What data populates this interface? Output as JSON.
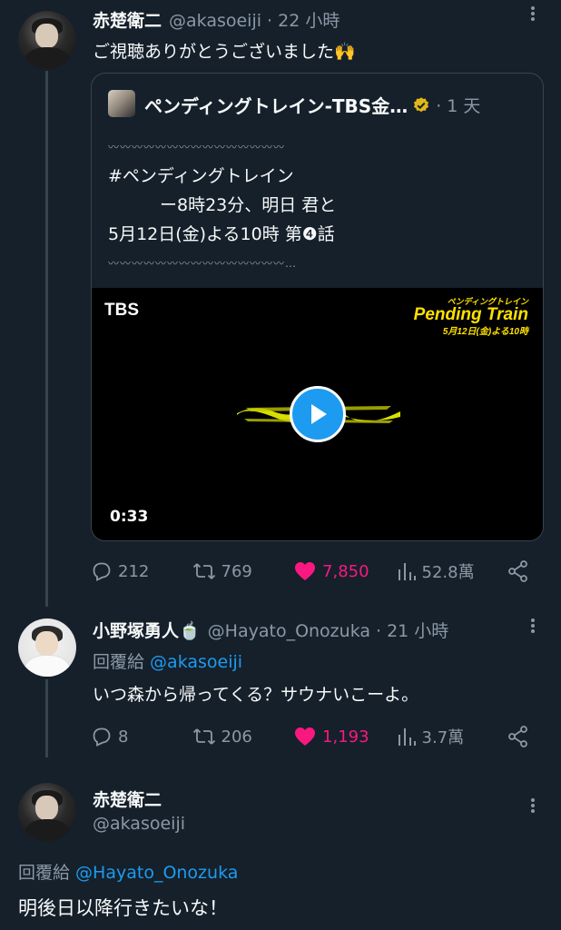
{
  "tweet1": {
    "name": "赤楚衛二",
    "handle": "@akasoeiji",
    "time": "· 22 小時",
    "text": "ご視聴ありがとうございました🙌",
    "quote": {
      "name": "ペンディングトレイン-TBS金…",
      "time": "· 1 天",
      "wave": "〰〰〰〰〰〰〰〰〰〰〰〰〰〰〰",
      "line1": "#ペンディングトレイン",
      "line2": "　　　ー8時23分、明日 君と",
      "line3": "5月12日(金)よる10時  第❹話",
      "wave2": "〰〰〰〰〰〰〰〰〰〰〰〰〰〰〰…",
      "video": {
        "channel": "TBS",
        "logo_small": "ペンディングトレイン",
        "logo_main": "Pending Train",
        "logo_date": "5月12日(金)よる10時",
        "duration": "0:33"
      }
    },
    "stats": {
      "replies": "212",
      "retweets": "769",
      "likes": "7,850",
      "views": "52.8萬"
    }
  },
  "tweet2": {
    "name": "小野塚勇人🍵",
    "handle": "@Hayato_Onozuka",
    "time": "· 21 小時",
    "reply_prefix": "回覆給 ",
    "reply_to": "@akasoeiji",
    "text": "いつ森から帰ってくる？サウナいこーよ。",
    "stats": {
      "replies": "8",
      "retweets": "206",
      "likes": "1,193",
      "views": "3.7萬"
    }
  },
  "tweet3": {
    "name": "赤楚衛二",
    "handle": "@akasoeiji",
    "reply_prefix": "回覆給 ",
    "reply_to": "@Hayato_Onozuka",
    "text": "明後日以降行きたいな！"
  },
  "colors": {
    "background": "#15202b",
    "accent": "#1d9bf0",
    "like": "#f91880",
    "muted": "#8b98a5"
  },
  "icons": [
    "more-icon",
    "verified-icon",
    "play-icon",
    "reply-icon",
    "retweet-icon",
    "heart-icon",
    "views-icon",
    "share-icon"
  ]
}
